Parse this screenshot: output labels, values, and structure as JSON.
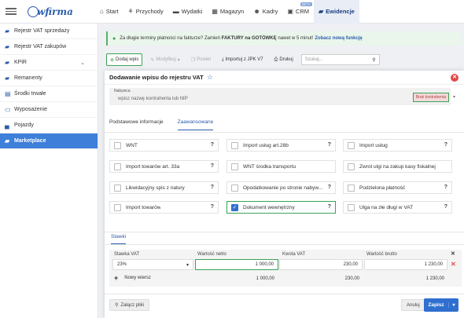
{
  "brand": {
    "logo_text": "wfirma"
  },
  "nav": [
    {
      "label": "Start",
      "icon": "home-icon"
    },
    {
      "label": "Przychody",
      "icon": "income-icon"
    },
    {
      "label": "Wydatki",
      "icon": "expenses-icon"
    },
    {
      "label": "Magazyn",
      "icon": "warehouse-icon"
    },
    {
      "label": "Kadry",
      "icon": "people-icon"
    },
    {
      "label": "CRM",
      "icon": "crm-icon",
      "badge": "BETA"
    },
    {
      "label": "Ewidencje",
      "icon": "folder-icon",
      "active": true
    }
  ],
  "sidebar": {
    "items": [
      {
        "label": "Rejestr VAT sprzedaży",
        "icon": "folder-icon",
        "active": false
      },
      {
        "label": "Rejestr VAT zakupów",
        "icon": "folder-icon",
        "active": false
      },
      {
        "label": "KPiR",
        "icon": "folder-icon",
        "active": false,
        "expandable": true
      },
      {
        "label": "Remanenty",
        "icon": "folder-icon",
        "active": false
      },
      {
        "label": "Środki trwałe",
        "icon": "document-icon",
        "active": false
      },
      {
        "label": "Wyposażenie",
        "icon": "equipment-icon",
        "active": false
      },
      {
        "label": "Pojazdy",
        "icon": "car-icon",
        "active": false
      },
      {
        "label": "Marketplace",
        "icon": "cart-icon",
        "active": true
      }
    ]
  },
  "banner": {
    "text_before": "Za długie terminy płatności na fakturze? Zamień",
    "text_bold": "FAKTURY na GOTÓWKĘ",
    "text_after": "nawet w 5 minut!",
    "link": "Zobacz nową funkcję"
  },
  "toolbar": {
    "add": "Dodaj wpis",
    "modify": "Modyfikuj",
    "repeat": "Powiel",
    "import": "Importuj z JPK V7",
    "print": "Drukuj",
    "search_placeholder": "Szukaj..."
  },
  "modal": {
    "title": "Dodawanie wpisu do rejestru VAT",
    "contractor": {
      "label": "Nabywca",
      "placeholder": "wpisz nazwę kontrahenta lub NIP",
      "no_contractor": "Brak kontrahenta"
    },
    "tabs": [
      "Podstawowe informacje",
      "Zaawansowane"
    ],
    "options": [
      {
        "label": "WNT",
        "checked": false,
        "help": "?"
      },
      {
        "label": "Import usług art.28b",
        "checked": false,
        "help": "?"
      },
      {
        "label": "Import usług",
        "checked": false,
        "help": "?"
      },
      {
        "label": "Import towarów art. 33a",
        "checked": false,
        "help": "?"
      },
      {
        "label": "WNT środka transportu",
        "checked": false,
        "help": ""
      },
      {
        "label": "Zwrot ulgi na zakup kasy fiskalnej",
        "checked": false,
        "help": ""
      },
      {
        "label": "Likwidacyjny spis z natury",
        "checked": false,
        "help": "?"
      },
      {
        "label": "Opodatkowanie po stronie nabyw...",
        "checked": false,
        "help": "?"
      },
      {
        "label": "Podzielona płatność",
        "checked": false,
        "help": "?"
      },
      {
        "label": "Import towarów",
        "checked": false,
        "help": "?"
      },
      {
        "label": "Dokument wewnętrzny",
        "checked": true,
        "help": "?"
      },
      {
        "label": "Ulga na złe długi w VAT",
        "checked": false,
        "help": "?"
      }
    ],
    "rates_tab": "Stawki",
    "rates": {
      "headers": [
        "Stawka VAT",
        "Wartość netto",
        "Kwota VAT",
        "Wartość brutto"
      ],
      "row": {
        "rate": "23%",
        "net": "1 000,00",
        "vat": "230,00",
        "gross": "1 230,00"
      },
      "new_row": "Nowy wiersz",
      "totals": {
        "net": "1 000,00",
        "vat": "230,00",
        "gross": "1 230,00"
      }
    },
    "attach": "Załącz pliki",
    "cancel": "Anuluj",
    "save": "Zapisz"
  }
}
